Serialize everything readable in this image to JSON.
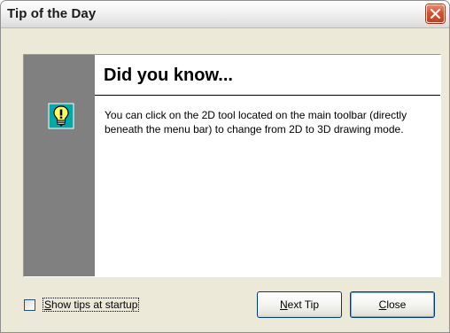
{
  "window": {
    "title": "Tip of the Day"
  },
  "tip": {
    "heading": "Did you know...",
    "text": "You can click on the 2D tool located on the main toolbar (directly beneath the menu bar) to change from 2D to 3D drawing mode."
  },
  "footer": {
    "show_tips_first": "S",
    "show_tips_rest": "how tips at startup",
    "show_tips_checked": false,
    "next_first": "N",
    "next_rest": "ext Tip",
    "close_first": "C",
    "close_rest": "lose"
  },
  "icons": {
    "close": "close-icon",
    "tip": "lightbulb-icon"
  },
  "colors": {
    "close_button": "#d8512d",
    "side_strip": "#808080"
  }
}
